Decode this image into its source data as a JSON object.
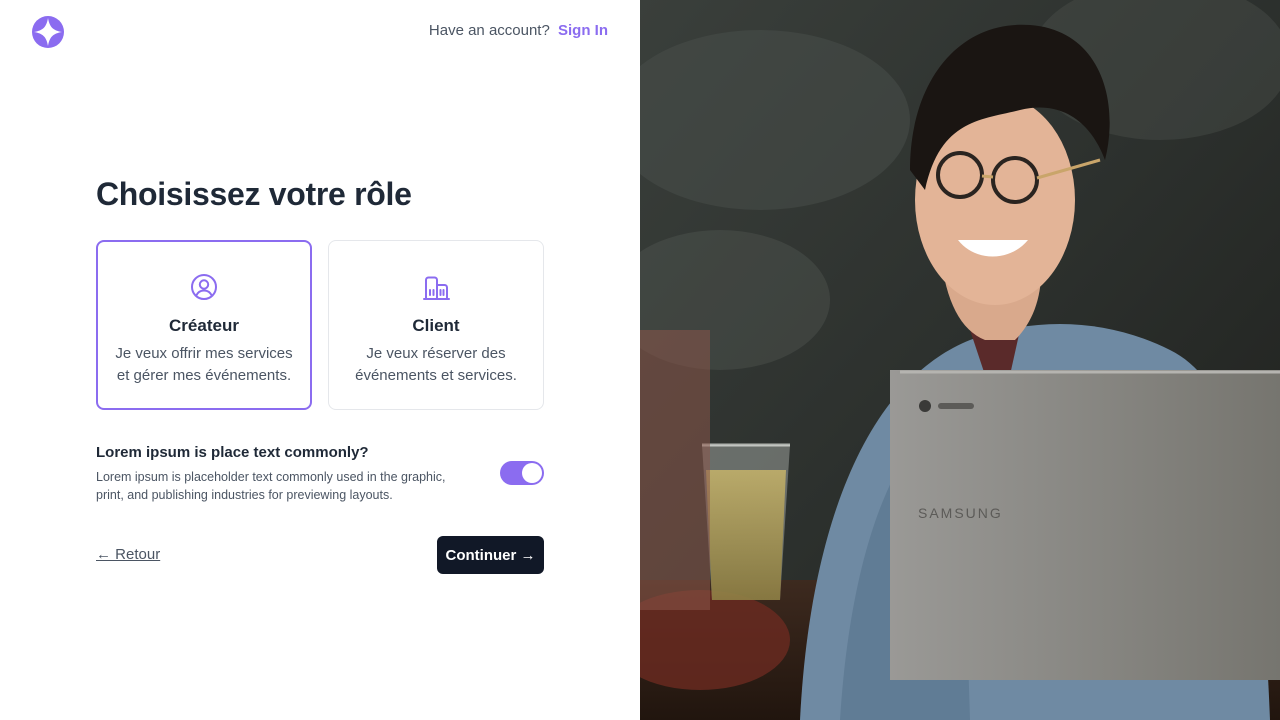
{
  "header": {
    "have_account_text": "Have an account?",
    "sign_in_label": "Sign In"
  },
  "main": {
    "title": "Choisissez votre rôle",
    "roles": [
      {
        "title": "Créateur",
        "description": "Je veux offrir mes services et gérer mes événements.",
        "icon": "user-circle-icon",
        "selected": true
      },
      {
        "title": "Client",
        "description": "Je veux réserver des événements et services.",
        "icon": "buildings-icon",
        "selected": false
      }
    ],
    "option": {
      "title": " Lorem ipsum is place text commonly?",
      "description": "Lorem ipsum is placeholder text commonly used in the graphic, print, and publishing industries for previewing layouts.",
      "toggle_on": true
    },
    "back_label": "← Retour",
    "continue_label": "Continuer →"
  },
  "colors": {
    "accent": "#8b6cf0",
    "primary_button": "#111827",
    "heading": "#1f2937",
    "muted_text": "#4b5563"
  },
  "photo": {
    "laptop_brand": "SAMSUNG"
  }
}
